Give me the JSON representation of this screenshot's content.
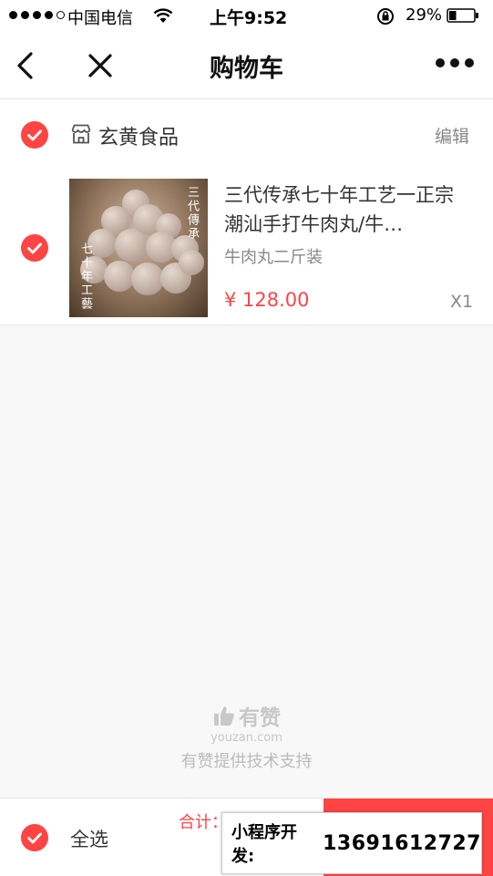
{
  "status_bar": {
    "carrier": "中国电信",
    "time": "上午9:52",
    "battery_percent": "29%",
    "battery_level": 0.29
  },
  "nav": {
    "title": "购物车",
    "back_icon": "chevron-left-icon",
    "close_icon": "close-icon",
    "more_icon": "more-dots-icon"
  },
  "shop": {
    "name": "玄黄食品",
    "edit_label": "编辑",
    "checked": true
  },
  "cart_items": [
    {
      "title": "三代传承七十年工艺一正宗潮汕手打牛肉丸/牛…",
      "sku": "牛肉丸二斤装",
      "price": "¥ 128.00",
      "quantity": "X1",
      "checked": true,
      "thumb_text_right": "三代傳承",
      "thumb_text_left": "七十年工藝"
    }
  ],
  "brand": {
    "name": "有赞",
    "url": "youzan.com",
    "support": "有赞提供技术支持"
  },
  "bottom_bar": {
    "select_all_label": "全选",
    "total_label": "合计："
  },
  "promo": {
    "label": "小程序开发:",
    "phone": "13691612727"
  },
  "colors": {
    "accent": "#ff4444",
    "background": "#f8f8f8",
    "muted_text": "#888888"
  }
}
